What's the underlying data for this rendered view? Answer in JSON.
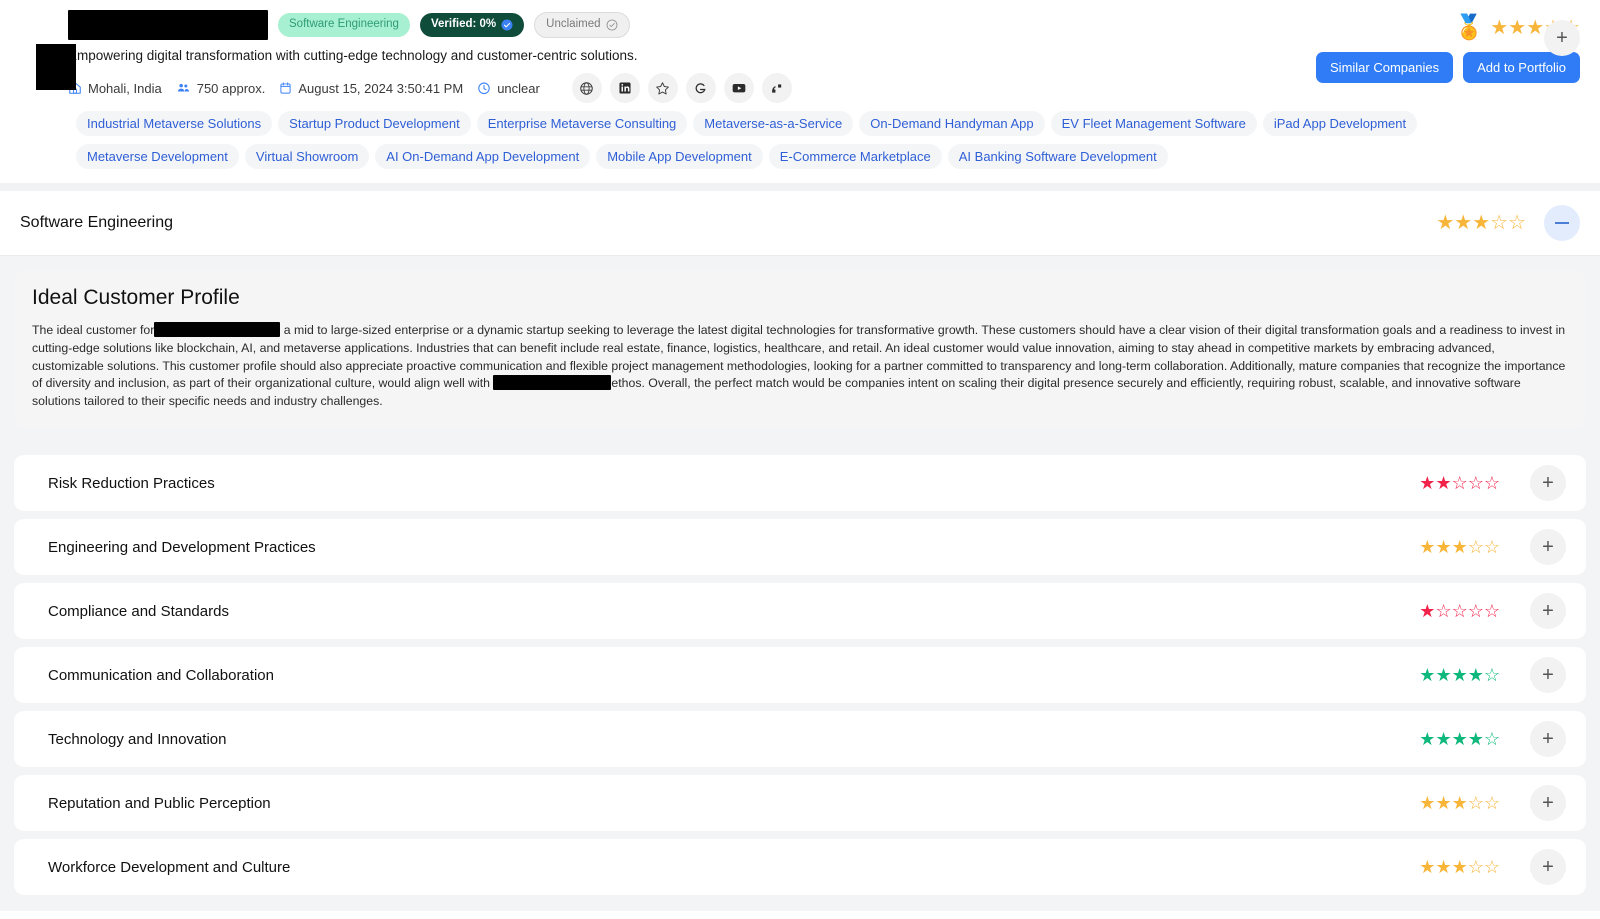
{
  "company": {
    "name_redacted": true,
    "tagline": "Empowering digital transformation with cutting-edge technology and customer-centric solutions.",
    "badges": [
      {
        "label": "Software Engineering",
        "type": "industry"
      },
      {
        "label": "Verified: 0%",
        "type": "verified"
      },
      {
        "label": "Unclaimed",
        "type": "unclaimed"
      }
    ],
    "meta": [
      {
        "icon": "location-icon",
        "label": "Mohali, India"
      },
      {
        "icon": "people-icon",
        "label": "750 approx."
      },
      {
        "icon": "calendar-icon",
        "label": "August 15, 2024 3:50:41 PM"
      },
      {
        "icon": "clock-icon",
        "label": "unclear"
      }
    ],
    "social_icons": [
      "globe-icon",
      "linkedin-icon",
      "clutch-star-icon",
      "goodfirms-g-icon",
      "youtube-icon",
      "quote-icon"
    ],
    "overall_rating": {
      "filled": 3,
      "total": 5,
      "color": "#f7b53a"
    },
    "medal_icon": "medal-award-icon",
    "actions": {
      "similar_companies": "Similar Companies",
      "add_to_portfolio": "Add to Portfolio",
      "expand": "+"
    }
  },
  "tags": [
    "Industrial Metaverse Solutions",
    "Startup Product Development",
    "Enterprise Metaverse Consulting",
    "Metaverse-as-a-Service",
    "On-Demand Handyman App",
    "EV Fleet Management Software",
    "iPad App Development",
    "Metaverse Development",
    "Virtual Showroom",
    "AI On-Demand App Development",
    "Mobile App Development",
    "E-Commerce Marketplace",
    "AI Banking Software Development"
  ],
  "section": {
    "title": "Software Engineering",
    "rating": {
      "filled": 3,
      "total": 5,
      "color": "#f7b53a"
    },
    "collapse_label": "−"
  },
  "icp": {
    "title": "Ideal Customer Profile",
    "text_part1": "The ideal customer for",
    "text_part2": "a mid to large-sized enterprise or a dynamic startup seeking to leverage the latest digital technologies for transformative growth. These customers should have a clear vision of their digital transformation goals and a readiness to invest in cutting-edge solutions like blockchain, AI, and metaverse applications. Industries that can benefit include real estate, finance, logistics, healthcare, and retail. An ideal customer would value innovation, aiming to stay ahead in competitive markets by embracing advanced, customizable solutions. This customer profile should also appreciate proactive communication and flexible project management methodologies, looking for a partner committed to transparency and long-term collaboration. Additionally, mature companies that recognize the importance of diversity and inclusion, as part of their organizational culture, would align well with",
    "text_part3": "ethos. Overall, the perfect match would be companies intent on scaling their digital presence securely and efficiently, requiring robust, scalable, and innovative software solutions tailored to their specific needs and industry challenges."
  },
  "criteria": [
    {
      "label": "Risk Reduction Practices",
      "filled": 2,
      "total": 5,
      "color": "#f1234b",
      "expand": "+"
    },
    {
      "label": "Engineering and Development Practices",
      "filled": 3,
      "total": 5,
      "color": "#f7b53a",
      "expand": "+"
    },
    {
      "label": "Compliance and Standards",
      "filled": 1,
      "total": 5,
      "color": "#f1234b",
      "expand": "+"
    },
    {
      "label": "Communication and Collaboration",
      "filled": 4,
      "total": 5,
      "color": "#0db87a",
      "expand": "+"
    },
    {
      "label": "Technology and Innovation",
      "filled": 4,
      "total": 5,
      "color": "#0db87a",
      "expand": "+"
    },
    {
      "label": "Reputation and Public Perception",
      "filled": 3,
      "total": 5,
      "color": "#f7b53a",
      "expand": "+"
    },
    {
      "label": "Workforce Development and Culture",
      "filled": 3,
      "total": 5,
      "color": "#f7b53a",
      "expand": "+"
    }
  ]
}
